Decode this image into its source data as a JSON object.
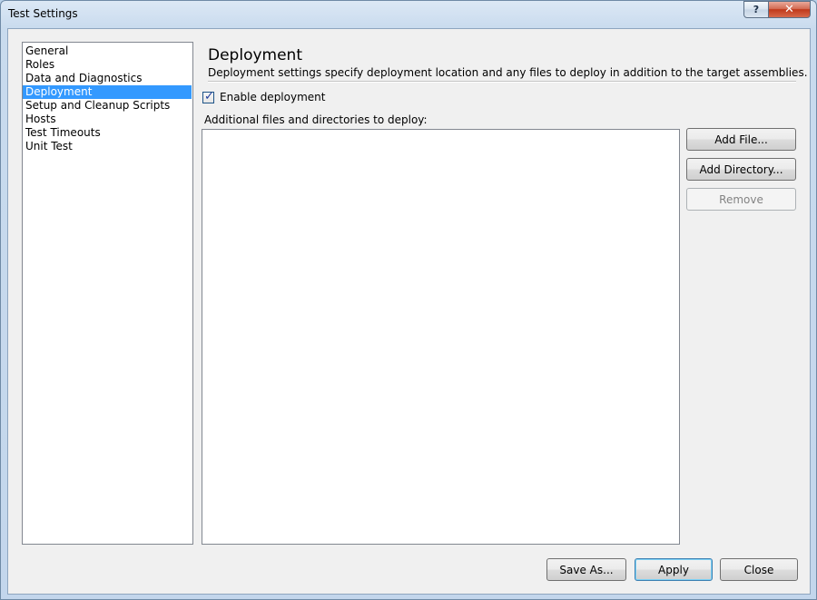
{
  "window": {
    "title": "Test Settings",
    "help_glyph": "?",
    "close_glyph": "✕"
  },
  "sidebar": {
    "items": [
      {
        "label": "General"
      },
      {
        "label": "Roles"
      },
      {
        "label": "Data and Diagnostics"
      },
      {
        "label": "Deployment",
        "selected": true
      },
      {
        "label": "Setup and Cleanup Scripts"
      },
      {
        "label": "Hosts"
      },
      {
        "label": "Test Timeouts"
      },
      {
        "label": "Unit Test"
      }
    ]
  },
  "panel": {
    "title": "Deployment",
    "description": "Deployment settings specify deployment location and any files to deploy in addition to the target assemblies.",
    "enable_label": "Enable deployment",
    "enable_checked": true,
    "files_label": "Additional files and directories to deploy:",
    "add_file_label": "Add File...",
    "add_directory_label": "Add Directory...",
    "remove_label": "Remove"
  },
  "footer": {
    "save_as_label": "Save As...",
    "apply_label": "Apply",
    "close_label": "Close"
  },
  "colors": {
    "selection": "#3399ff",
    "dialog_bg": "#f0f0f0"
  }
}
